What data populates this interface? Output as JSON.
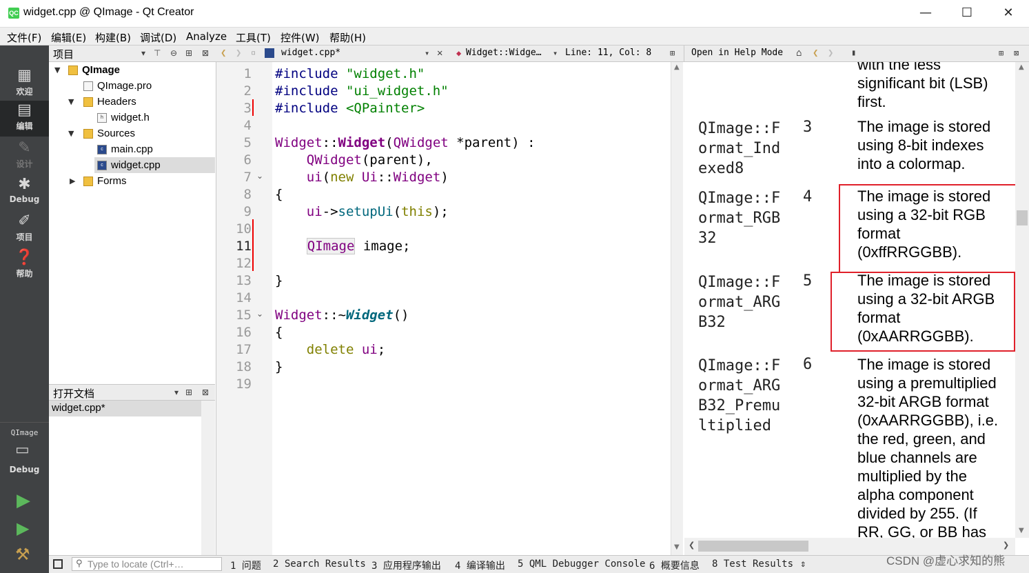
{
  "window": {
    "title": "widget.cpp @ QImage - Qt Creator",
    "app_badge": "QC",
    "controls": {
      "minimize": "—",
      "maximize": "☐",
      "close": "✕"
    }
  },
  "menu": [
    "文件(F)",
    "编辑(E)",
    "构建(B)",
    "调试(D)",
    "Analyze",
    "工具(T)",
    "控件(W)",
    "帮助(H)"
  ],
  "modes": [
    {
      "label": "欢迎",
      "icon": "grid-icon"
    },
    {
      "label": "编辑",
      "icon": "edit-icon"
    },
    {
      "label": "设计",
      "icon": "pencil-icon"
    },
    {
      "label": "Debug",
      "icon": "bug-icon"
    },
    {
      "label": "项目",
      "icon": "wrench-icon"
    },
    {
      "label": "帮助",
      "icon": "help-icon"
    }
  ],
  "kit": {
    "project": "QImage",
    "config": "Debug"
  },
  "project_panel": {
    "title": "项目",
    "tree": [
      {
        "label": "QImage",
        "level": 0,
        "expanded": true,
        "bold": true
      },
      {
        "label": "QImage.pro",
        "level": 1
      },
      {
        "label": "Headers",
        "level": 1,
        "expanded": true
      },
      {
        "label": "widget.h",
        "level": 2
      },
      {
        "label": "Sources",
        "level": 1,
        "expanded": true
      },
      {
        "label": "main.cpp",
        "level": 2
      },
      {
        "label": "widget.cpp",
        "level": 2,
        "selected": true
      },
      {
        "label": "Forms",
        "level": 1,
        "expanded": false
      }
    ]
  },
  "open_docs": {
    "title": "打开文档",
    "items": [
      "widget.cpp*"
    ]
  },
  "editor": {
    "file_tab": "widget.cpp*",
    "symbol": "Widget::Widge…",
    "position": "Line: 11, Col: 8",
    "line_numbers": [
      "1",
      "2",
      "3",
      "4",
      "5",
      "6",
      "7",
      "8",
      "9",
      "10",
      "11",
      "12",
      "13",
      "14",
      "15",
      "16",
      "17",
      "18",
      "19"
    ],
    "current_line": "11"
  },
  "help": {
    "mode_label": "Open in Help Mode",
    "top_fragment": [
      "with the less",
      "significant bit (LSB)",
      "first."
    ],
    "rows": [
      {
        "name": "QImage::Format_Indexed8",
        "value": "3",
        "desc": "The image is stored using 8-bit indexes into a colormap."
      },
      {
        "name": "QImage::Format_RGB32",
        "value": "4",
        "desc": "The image is stored using a 32-bit RGB format (0xffRRGGBB)."
      },
      {
        "name": "QImage::Format_ARGB32",
        "value": "5",
        "desc": "The image is stored using a 32-bit ARGB format (0xAARRGGBB)."
      },
      {
        "name": "QImage::Format_ARGB32_Premultiplied",
        "value": "6",
        "desc": "The image is stored using a premultiplied 32-bit ARGB format (0xAARRGGBB), i.e. the red, green, and blue channels are multiplied by the alpha component divided by 255. (If RR, GG, or BB has"
      }
    ]
  },
  "status": {
    "locator_placeholder": "Type to locate (Ctrl+…",
    "tabs": [
      "1 问题",
      "2 Search Results",
      "3 应用程序输出",
      "4 编译输出",
      "5 QML Debugger Console",
      "6 概要信息",
      "8 Test Results"
    ]
  },
  "watermark": "CSDN @虚心求知的熊",
  "colors": {
    "sidebar": "#404244",
    "highlight": "#e0202a",
    "keyword": "#808000",
    "string": "#008000",
    "class": "#800080"
  }
}
